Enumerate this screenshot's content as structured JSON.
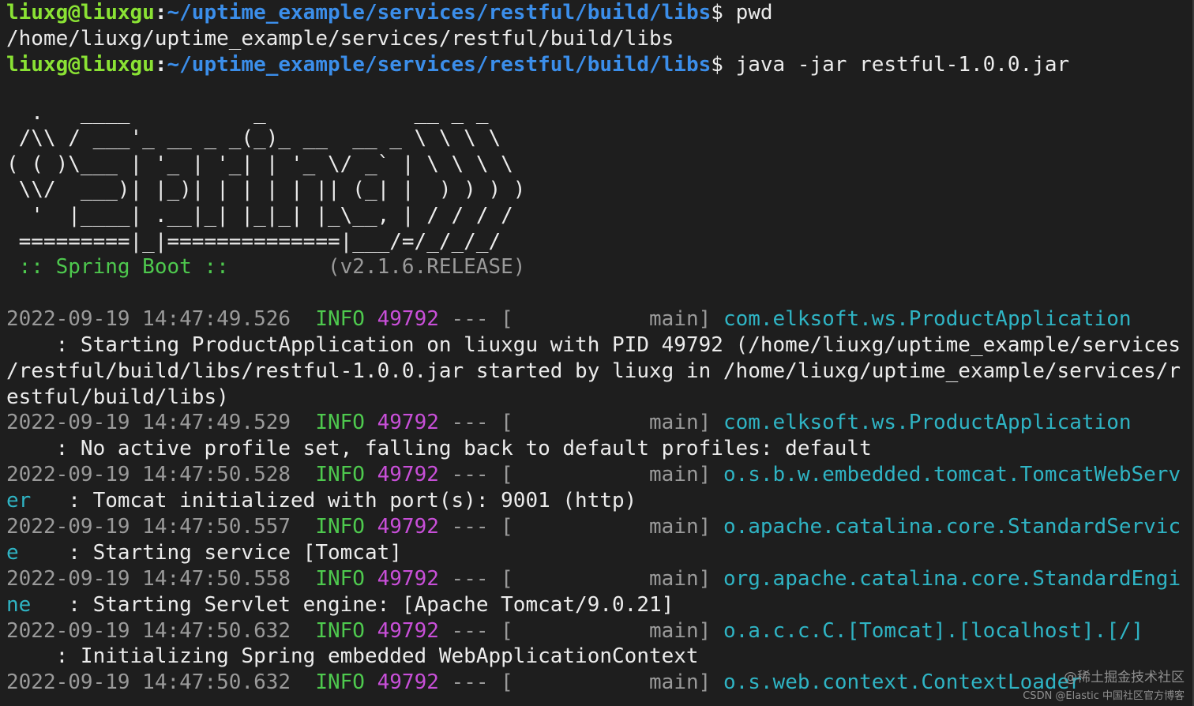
{
  "colors": {
    "background": "#1e1e1e",
    "text": "#ececec",
    "prompt_user": "#8ae234",
    "prompt_path": "#3b8eea",
    "timestamp": "#9a9a9a",
    "info": "#4ec94e",
    "pid": "#c84fd8",
    "logger": "#2fb4c4",
    "spring_boot": "#4ec94e"
  },
  "prompt": {
    "user": "liuxg@liuxgu",
    "colon": ":",
    "path": "~/uptime_example/services/restful/build/libs",
    "symbol": "$ "
  },
  "commands": {
    "cmd1": "pwd",
    "output1": "/home/liuxg/uptime_example/services/restful/build/libs",
    "cmd2": "java -jar restful-1.0.0.jar"
  },
  "banner": {
    "lines": [
      "  .   ____          _            __ _ _",
      " /\\\\ / ___'_ __ _ _(_)_ __  __ _ \\ \\ \\ \\",
      "( ( )\\___ | '_ | '_| | '_ \\/ _` | \\ \\ \\ \\",
      " \\\\/  ___)| |_)| | | | | || (_| |  ) ) ) )",
      "  '  |____| .__|_| |_|_| |_\\__, | / / / /",
      " =========|_|==============|___/=/_/_/_/"
    ],
    "label": " :: Spring Boot :: ",
    "version": "       (v2.1.6.RELEASE)"
  },
  "logs": [
    {
      "timestamp": "2022-09-19 14:47:49.526",
      "level": "INFO",
      "pid": "49792",
      "sep": " --- [",
      "thread": "           main]",
      "logger": "com.elksoft.ws.ProductApplication",
      "logger_cont": "",
      "message_lines": [
        "    : Starting ProductApplication on liuxgu with PID 49792 (/home/liuxg/uptime_example/services",
        "/restful/build/libs/restful-1.0.0.jar started by liuxg in /home/liuxg/uptime_example/services/r",
        "estful/build/libs)"
      ]
    },
    {
      "timestamp": "2022-09-19 14:47:49.529",
      "level": "INFO",
      "pid": "49792",
      "sep": " --- [",
      "thread": "           main]",
      "logger": "com.elksoft.ws.ProductApplication",
      "logger_cont": "",
      "message_lines": [
        "    : No active profile set, falling back to default profiles: default"
      ]
    },
    {
      "timestamp": "2022-09-19 14:47:50.528",
      "level": "INFO",
      "pid": "49792",
      "sep": " --- [",
      "thread": "           main]",
      "logger": "o.s.b.w.embedded.tomcat.TomcatWebServ",
      "logger_cont": "er",
      "message_lines": [
        "   : Tomcat initialized with port(s): 9001 (http)"
      ]
    },
    {
      "timestamp": "2022-09-19 14:47:50.557",
      "level": "INFO",
      "pid": "49792",
      "sep": " --- [",
      "thread": "           main]",
      "logger": "o.apache.catalina.core.StandardServic",
      "logger_cont": "e",
      "message_lines": [
        "    : Starting service [Tomcat]"
      ]
    },
    {
      "timestamp": "2022-09-19 14:47:50.558",
      "level": "INFO",
      "pid": "49792",
      "sep": " --- [",
      "thread": "           main]",
      "logger": "org.apache.catalina.core.StandardEngi",
      "logger_cont": "ne",
      "message_lines": [
        "   : Starting Servlet engine: [Apache Tomcat/9.0.21]"
      ]
    },
    {
      "timestamp": "2022-09-19 14:47:50.632",
      "level": "INFO",
      "pid": "49792",
      "sep": " --- [",
      "thread": "           main]",
      "logger": "o.a.c.c.C.[Tomcat].[localhost].[/]",
      "logger_cont": "",
      "message_lines": [
        "    : Initializing Spring embedded WebApplicationContext"
      ]
    },
    {
      "timestamp": "2022-09-19 14:47:50.632",
      "level": "INFO",
      "pid": "49792",
      "sep": " --- [",
      "thread": "           main]",
      "logger": "o.s.web.context.ContextLoader",
      "logger_cont": "",
      "message_lines": []
    }
  ],
  "watermark": {
    "juejin": "@稀土掘金技术社区",
    "csdn": "CSDN @Elastic 中国社区官方博客"
  }
}
